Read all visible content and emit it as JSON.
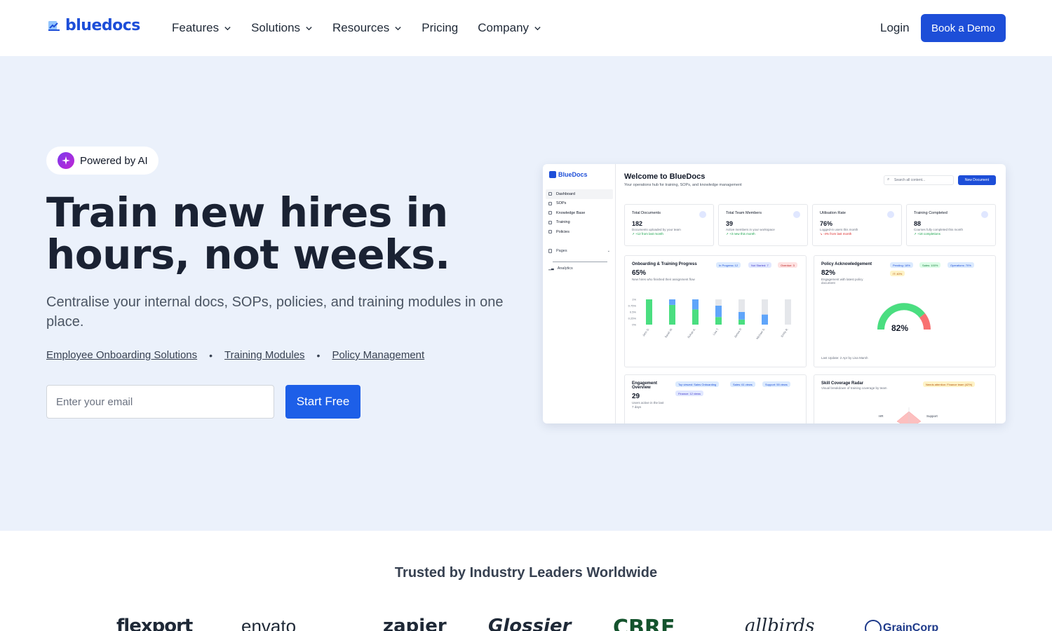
{
  "brand": {
    "name": "bluedocs",
    "color": "#1d4ed8"
  },
  "nav": {
    "items": [
      {
        "label": "Features",
        "dropdown": true
      },
      {
        "label": "Solutions",
        "dropdown": true
      },
      {
        "label": "Resources",
        "dropdown": true
      },
      {
        "label": "Pricing",
        "dropdown": false
      },
      {
        "label": "Company",
        "dropdown": true
      }
    ],
    "login": "Login",
    "demo": "Book a Demo"
  },
  "hero": {
    "badge": "Powered by AI",
    "headline_line1": "Train new hires in",
    "headline_line2": "hours, not weeks.",
    "subhead": "Centralise your internal docs, SOPs, policies, and training modules in one place.",
    "links": [
      "Employee Onboarding Solutions",
      "Training Modules",
      "Policy Management"
    ],
    "email_placeholder": "Enter your email",
    "cta": "Start Free"
  },
  "dashboard": {
    "logo": "BlueDocs",
    "sidebar": [
      "Dashboard",
      "SOPs",
      "Knowledge Base",
      "Training",
      "Policies"
    ],
    "pages": "Pages",
    "analytics": "Analytics",
    "title": "Welcome to BlueDocs",
    "subtitle": "Your operations hub for training, SOPs, and knowledge management",
    "search_placeholder": "Search all content...",
    "new_button": "New Document",
    "stats": [
      {
        "label": "Total Documents",
        "value": "182",
        "desc": "Documents uploaded by your team",
        "delta": "↗ +12 from last month",
        "negative": false
      },
      {
        "label": "Total Team Members",
        "value": "39",
        "desc": "Active members in your workspace",
        "delta": "↗ +3 new this month",
        "negative": false
      },
      {
        "label": "Utilisation Rate",
        "value": "76%",
        "desc": "Logged-in users this month",
        "delta": "↘ -4% from last month",
        "negative": true
      },
      {
        "label": "Training Completed",
        "value": "88",
        "desc": "Courses fully completed this month",
        "delta": "↗ +18 completions",
        "negative": false
      }
    ],
    "onboarding": {
      "title": "Onboarding & Training Progress",
      "value": "65%",
      "desc": "New hires who finished their assignment flow",
      "chips": [
        "In Progress: 12",
        "Not Started: 7",
        "Overdue: 3"
      ]
    },
    "policy": {
      "title": "Policy Acknowledgement",
      "value": "82%",
      "desc": "Engagement with latest policy document",
      "chips": [
        "Pending: 18%",
        "Sales: 100%",
        "Operations: 70%",
        "IT: 40%"
      ],
      "gauge": "82%",
      "footer": "Last Update: 2 Apr by Lisa Marsh"
    },
    "engagement": {
      "title_line1": "Engagement",
      "title_line2": "Overview",
      "value": "29",
      "desc_line1": "Users active in the last",
      "desc_line2": "7 days",
      "chips": [
        "Top viewed: Sales Onboarding",
        "Sales: 61 views",
        "Support: 55 views",
        "Finance: 12 views"
      ]
    },
    "radar": {
      "title": "Skill Coverage Radar",
      "desc": "Visual breakdown of training coverage by team",
      "chip": "Needs attention: Finance team (42%)",
      "labels": [
        "HR",
        "Support"
      ]
    }
  },
  "chart_data": {
    "type": "bar",
    "categories": [
      "John D.",
      "Sarah M.",
      "Rohan K.",
      "Lisa T.",
      "James P.",
      "Michael S.",
      "Emily R."
    ],
    "ytick_labels": [
      "1%",
      "0.75%",
      "0.5%",
      "0.25%",
      "0%"
    ],
    "series": [
      {
        "name": "completed",
        "color": "#4ade80",
        "values": [
          1.0,
          0.78,
          0.6,
          0.3,
          0.2,
          0.0,
          0.0
        ]
      },
      {
        "name": "in_progress",
        "color": "#60a5fa",
        "values": [
          0.0,
          0.22,
          0.4,
          0.45,
          0.3,
          0.4,
          0.0
        ]
      },
      {
        "name": "not_started",
        "color": "#e5e7eb",
        "values": [
          0.0,
          0.0,
          0.0,
          0.25,
          0.5,
          0.6,
          1.0
        ]
      }
    ]
  },
  "trusted": {
    "title": "Trusted by Industry Leaders Worldwide",
    "logos": [
      "flexport",
      "envato",
      "zapier",
      "Glossier",
      "CBRE",
      "allbirds",
      "GrainCorp"
    ]
  }
}
